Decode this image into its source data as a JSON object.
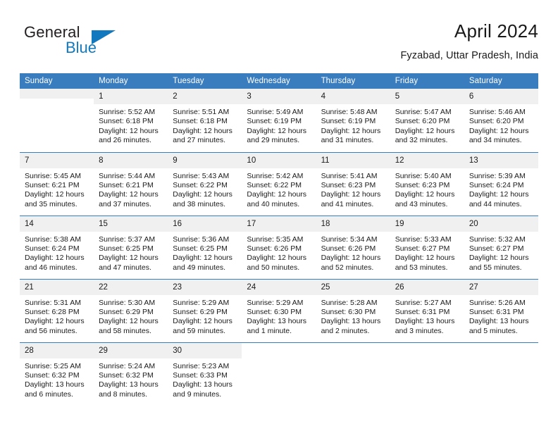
{
  "brand": {
    "name_part1": "General",
    "name_part2": "Blue",
    "accent_color": "#1279bf",
    "triangle_icon": "triangle-icon"
  },
  "header": {
    "title": "April 2024",
    "subtitle": "Fyzabad, Uttar Pradesh, India"
  },
  "theme": {
    "header_blue": "#3a7dbf",
    "daynum_band": "#f0f0f0",
    "text": "#1a1a1a"
  },
  "weekdays": [
    "Sunday",
    "Monday",
    "Tuesday",
    "Wednesday",
    "Thursday",
    "Friday",
    "Saturday"
  ],
  "labels": {
    "sunrise": "Sunrise:",
    "sunset": "Sunset:",
    "daylight": "Daylight:"
  },
  "weeks": [
    [
      {
        "day": ""
      },
      {
        "day": "1",
        "sunrise": "Sunrise: 5:52 AM",
        "sunset": "Sunset: 6:18 PM",
        "daylight_a": "Daylight: 12 hours",
        "daylight_b": "and 26 minutes."
      },
      {
        "day": "2",
        "sunrise": "Sunrise: 5:51 AM",
        "sunset": "Sunset: 6:18 PM",
        "daylight_a": "Daylight: 12 hours",
        "daylight_b": "and 27 minutes."
      },
      {
        "day": "3",
        "sunrise": "Sunrise: 5:49 AM",
        "sunset": "Sunset: 6:19 PM",
        "daylight_a": "Daylight: 12 hours",
        "daylight_b": "and 29 minutes."
      },
      {
        "day": "4",
        "sunrise": "Sunrise: 5:48 AM",
        "sunset": "Sunset: 6:19 PM",
        "daylight_a": "Daylight: 12 hours",
        "daylight_b": "and 31 minutes."
      },
      {
        "day": "5",
        "sunrise": "Sunrise: 5:47 AM",
        "sunset": "Sunset: 6:20 PM",
        "daylight_a": "Daylight: 12 hours",
        "daylight_b": "and 32 minutes."
      },
      {
        "day": "6",
        "sunrise": "Sunrise: 5:46 AM",
        "sunset": "Sunset: 6:20 PM",
        "daylight_a": "Daylight: 12 hours",
        "daylight_b": "and 34 minutes."
      }
    ],
    [
      {
        "day": "7",
        "sunrise": "Sunrise: 5:45 AM",
        "sunset": "Sunset: 6:21 PM",
        "daylight_a": "Daylight: 12 hours",
        "daylight_b": "and 35 minutes."
      },
      {
        "day": "8",
        "sunrise": "Sunrise: 5:44 AM",
        "sunset": "Sunset: 6:21 PM",
        "daylight_a": "Daylight: 12 hours",
        "daylight_b": "and 37 minutes."
      },
      {
        "day": "9",
        "sunrise": "Sunrise: 5:43 AM",
        "sunset": "Sunset: 6:22 PM",
        "daylight_a": "Daylight: 12 hours",
        "daylight_b": "and 38 minutes."
      },
      {
        "day": "10",
        "sunrise": "Sunrise: 5:42 AM",
        "sunset": "Sunset: 6:22 PM",
        "daylight_a": "Daylight: 12 hours",
        "daylight_b": "and 40 minutes."
      },
      {
        "day": "11",
        "sunrise": "Sunrise: 5:41 AM",
        "sunset": "Sunset: 6:23 PM",
        "daylight_a": "Daylight: 12 hours",
        "daylight_b": "and 41 minutes."
      },
      {
        "day": "12",
        "sunrise": "Sunrise: 5:40 AM",
        "sunset": "Sunset: 6:23 PM",
        "daylight_a": "Daylight: 12 hours",
        "daylight_b": "and 43 minutes."
      },
      {
        "day": "13",
        "sunrise": "Sunrise: 5:39 AM",
        "sunset": "Sunset: 6:24 PM",
        "daylight_a": "Daylight: 12 hours",
        "daylight_b": "and 44 minutes."
      }
    ],
    [
      {
        "day": "14",
        "sunrise": "Sunrise: 5:38 AM",
        "sunset": "Sunset: 6:24 PM",
        "daylight_a": "Daylight: 12 hours",
        "daylight_b": "and 46 minutes."
      },
      {
        "day": "15",
        "sunrise": "Sunrise: 5:37 AM",
        "sunset": "Sunset: 6:25 PM",
        "daylight_a": "Daylight: 12 hours",
        "daylight_b": "and 47 minutes."
      },
      {
        "day": "16",
        "sunrise": "Sunrise: 5:36 AM",
        "sunset": "Sunset: 6:25 PM",
        "daylight_a": "Daylight: 12 hours",
        "daylight_b": "and 49 minutes."
      },
      {
        "day": "17",
        "sunrise": "Sunrise: 5:35 AM",
        "sunset": "Sunset: 6:26 PM",
        "daylight_a": "Daylight: 12 hours",
        "daylight_b": "and 50 minutes."
      },
      {
        "day": "18",
        "sunrise": "Sunrise: 5:34 AM",
        "sunset": "Sunset: 6:26 PM",
        "daylight_a": "Daylight: 12 hours",
        "daylight_b": "and 52 minutes."
      },
      {
        "day": "19",
        "sunrise": "Sunrise: 5:33 AM",
        "sunset": "Sunset: 6:27 PM",
        "daylight_a": "Daylight: 12 hours",
        "daylight_b": "and 53 minutes."
      },
      {
        "day": "20",
        "sunrise": "Sunrise: 5:32 AM",
        "sunset": "Sunset: 6:27 PM",
        "daylight_a": "Daylight: 12 hours",
        "daylight_b": "and 55 minutes."
      }
    ],
    [
      {
        "day": "21",
        "sunrise": "Sunrise: 5:31 AM",
        "sunset": "Sunset: 6:28 PM",
        "daylight_a": "Daylight: 12 hours",
        "daylight_b": "and 56 minutes."
      },
      {
        "day": "22",
        "sunrise": "Sunrise: 5:30 AM",
        "sunset": "Sunset: 6:29 PM",
        "daylight_a": "Daylight: 12 hours",
        "daylight_b": "and 58 minutes."
      },
      {
        "day": "23",
        "sunrise": "Sunrise: 5:29 AM",
        "sunset": "Sunset: 6:29 PM",
        "daylight_a": "Daylight: 12 hours",
        "daylight_b": "and 59 minutes."
      },
      {
        "day": "24",
        "sunrise": "Sunrise: 5:29 AM",
        "sunset": "Sunset: 6:30 PM",
        "daylight_a": "Daylight: 13 hours",
        "daylight_b": "and 1 minute."
      },
      {
        "day": "25",
        "sunrise": "Sunrise: 5:28 AM",
        "sunset": "Sunset: 6:30 PM",
        "daylight_a": "Daylight: 13 hours",
        "daylight_b": "and 2 minutes."
      },
      {
        "day": "26",
        "sunrise": "Sunrise: 5:27 AM",
        "sunset": "Sunset: 6:31 PM",
        "daylight_a": "Daylight: 13 hours",
        "daylight_b": "and 3 minutes."
      },
      {
        "day": "27",
        "sunrise": "Sunrise: 5:26 AM",
        "sunset": "Sunset: 6:31 PM",
        "daylight_a": "Daylight: 13 hours",
        "daylight_b": "and 5 minutes."
      }
    ],
    [
      {
        "day": "28",
        "sunrise": "Sunrise: 5:25 AM",
        "sunset": "Sunset: 6:32 PM",
        "daylight_a": "Daylight: 13 hours",
        "daylight_b": "and 6 minutes."
      },
      {
        "day": "29",
        "sunrise": "Sunrise: 5:24 AM",
        "sunset": "Sunset: 6:32 PM",
        "daylight_a": "Daylight: 13 hours",
        "daylight_b": "and 8 minutes."
      },
      {
        "day": "30",
        "sunrise": "Sunrise: 5:23 AM",
        "sunset": "Sunset: 6:33 PM",
        "daylight_a": "Daylight: 13 hours",
        "daylight_b": "and 9 minutes."
      },
      {
        "day": ""
      },
      {
        "day": ""
      },
      {
        "day": ""
      },
      {
        "day": ""
      }
    ]
  ]
}
